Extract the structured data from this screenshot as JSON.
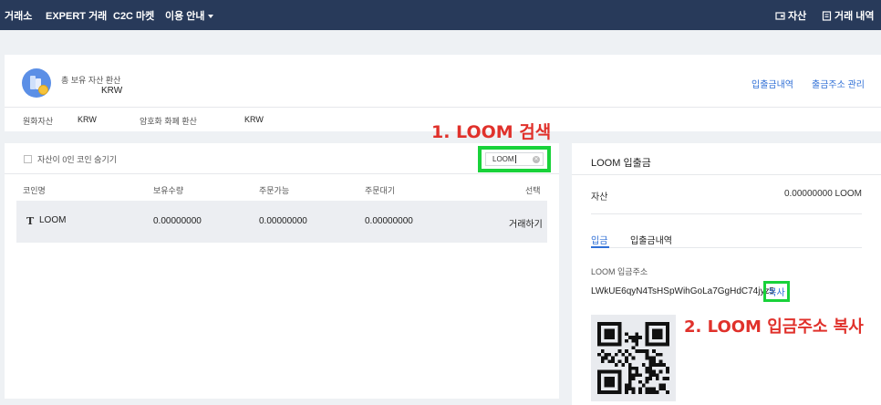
{
  "nav": {
    "items": [
      "거래소",
      "EXPERT 거래",
      "C2C 마켓",
      "이용 안내"
    ],
    "asset_label": "자산",
    "history_label": "거래 내역"
  },
  "summary": {
    "total_label": "총 보유 자산 환산",
    "total_value": "KRW",
    "links": [
      "입출금내역",
      "출금주소 관리"
    ],
    "krw_asset_label": "원화자산",
    "krw_asset_value": "KRW",
    "crypto_label": "암호화 화폐 환산",
    "crypto_value": "KRW"
  },
  "holdings": {
    "hide_zero_label": "자산이 0인 코인 숨기기",
    "search_value": "LOOM",
    "headers": [
      "코인명",
      "보유수량",
      "주문가능",
      "주문대기",
      "선택"
    ],
    "rows": [
      {
        "coin": "LOOM",
        "holding": "0.00000000",
        "available": "0.00000000",
        "pending": "0.00000000",
        "action": "거래하기"
      }
    ]
  },
  "annotations": {
    "step1": "1. LOOM 검색",
    "step2": "2. LOOM 입금주소 복사"
  },
  "deposit": {
    "title": "LOOM  입출금",
    "asset_label": "자산",
    "asset_value": "0.00000000 LOOM",
    "tabs": [
      "입금",
      "입출금내역"
    ],
    "active_tab": 0,
    "address_label": "LOOM  입금주소",
    "address": "LWkUE6qyN4TsHSpWihGoLa7GgHdC74jyz5",
    "copy_label": "복사"
  },
  "colors": {
    "nav_bg": "#283a5a",
    "link": "#2f6fd6",
    "highlight": "#19d23a",
    "annotation": "#e0312b"
  }
}
